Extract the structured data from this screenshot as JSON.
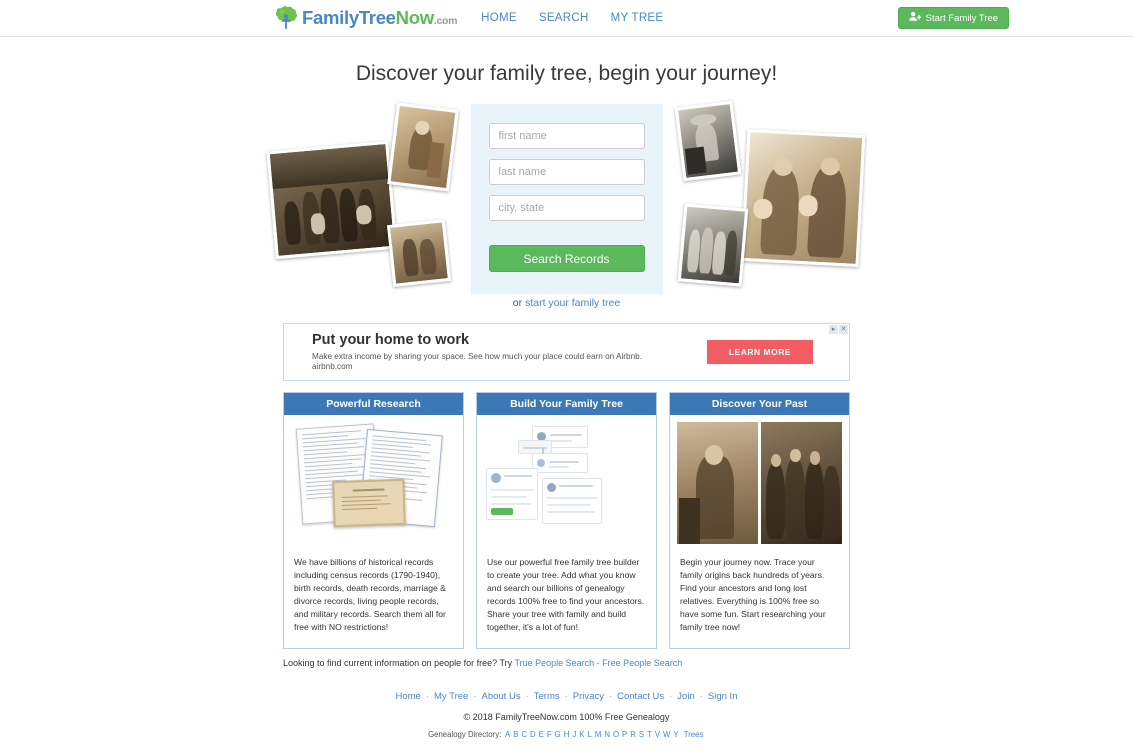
{
  "header": {
    "logo": {
      "icon": "tree-icon",
      "part1": "Family",
      "part2": "Tree",
      "part3": "Now",
      "part4": ".com"
    },
    "nav": [
      {
        "label": "HOME"
      },
      {
        "label": "SEARCH"
      },
      {
        "label": "MY TREE"
      }
    ],
    "start_button": {
      "label": "Start Family Tree",
      "icon": "person-plus-icon",
      "color": "#5cb85c"
    }
  },
  "hero": {
    "title": "Discover your family tree, begin your journey!",
    "search": {
      "first_name_placeholder": "first name",
      "last_name_placeholder": "last name",
      "city_state_placeholder": "city, state",
      "first_name_value": "",
      "last_name_value": "",
      "city_state_value": "",
      "button_label": "Search Records",
      "button_color": "#5cb85c",
      "panel_color": "#e8f3fa"
    },
    "or_text": "or ",
    "or_link": "start your family tree",
    "left_collage_alt": "vintage sepia family photographs",
    "right_collage_alt": "vintage sepia portrait photographs"
  },
  "ad": {
    "title": "Put your home to work",
    "description": "Make extra income by sharing your space. See how much your place could earn on Airbnb.",
    "url": "airbnb.com",
    "cta_label": "LEARN MORE",
    "cta_color": "#f25c63",
    "adchoices_icon": "adchoices-icon",
    "close_icon": "close-icon"
  },
  "cards": [
    {
      "title": "Powerful Research",
      "image_alt": "historical census records and certificate",
      "text": "We have billions of historical records including census records (1790-1940), birth records, death records, marriage & divorce records, living people records, and military records. Search them all for free with NO restrictions!"
    },
    {
      "title": "Build Your Family Tree",
      "image_alt": "family tree builder interface screenshot",
      "text": "Use our powerful free family tree builder to create your tree. Add what you know and search our billions of genealogy records 100% free to find your ancestors. Share your tree with family and build together, it's a lot of fun!"
    },
    {
      "title": "Discover Your Past",
      "image_alt": "vintage portrait photographs of ancestors",
      "text": "Begin your journey now. Trace your family origins back hundreds of years. Find your ancestors and long lost relatives. Everything is 100% free so have some fun. Start researching your family tree now!"
    }
  ],
  "people_search": {
    "prefix": "Looking to find current information on people for free? Try ",
    "link": "True People Search - Free People Search"
  },
  "footer": {
    "nav": [
      {
        "label": "Home"
      },
      {
        "label": "My Tree"
      },
      {
        "label": "About Us"
      },
      {
        "label": "Terms"
      },
      {
        "label": "Privacy"
      },
      {
        "label": "Contact Us"
      },
      {
        "label": "Join"
      },
      {
        "label": "Sign In"
      }
    ],
    "copyright": "© 2018 FamilyTreeNow.com 100% Free Genealogy",
    "directory_label": "Genealogy Directory:",
    "directory_letters": [
      "A",
      "B",
      "C",
      "D",
      "E",
      "F",
      "G",
      "H",
      "J",
      "K",
      "L",
      "M",
      "N",
      "O",
      "P",
      "R",
      "S",
      "T",
      "V",
      "W",
      "Y"
    ],
    "directory_trees": "Trees"
  },
  "theme": {
    "brand_blue": "#4b86c8",
    "brand_green": "#5cb85c",
    "card_header_blue": "#3b78b5",
    "panel_blue": "#e8f3fa"
  }
}
